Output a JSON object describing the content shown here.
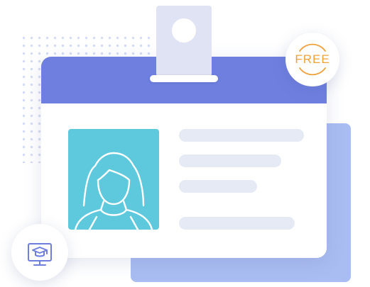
{
  "free_badge": {
    "label": "FREE",
    "color": "#f0a23a"
  },
  "education_badge": {
    "icon": "graduation-cap-monitor-icon",
    "color": "#6e7fe0"
  },
  "id_card": {
    "header_color": "#6e7fe0",
    "photo_color": "#5ec9dc",
    "avatar_icon": "person-avatar-icon",
    "back_card_color": "#a9bdf2",
    "text_line_color": "#e6eaf4"
  }
}
